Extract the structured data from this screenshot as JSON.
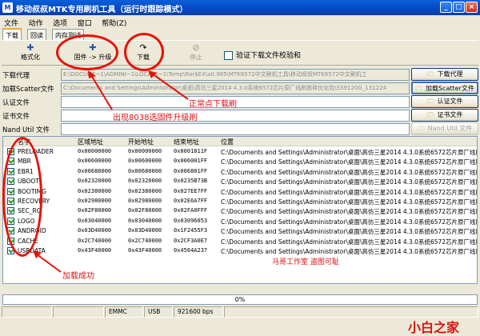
{
  "window": {
    "title": "移动叔叔MTK专用刷机工具（运行时跟踪模式）",
    "icon": "app-icon",
    "min": "_",
    "max": "□",
    "close": "×"
  },
  "menu": [
    "文件",
    "动作",
    "选项",
    "窗口",
    "帮助(Z)"
  ],
  "tabs": [
    "下载",
    "回读",
    "内存测试"
  ],
  "toolbar": {
    "format": "格式化",
    "firmware_upgrade": "固件 -> 升级",
    "download": "下载",
    "stop": "停止",
    "verify_label": "验证下载文件校验和"
  },
  "rows": [
    {
      "label": "下载代理",
      "value": "E:\\DOCUME~1\\ADMINI~1\\LOCALS~1\\Temp\\Rar$EX\\a0.985\\MTK6572中文刷机工具\\移动叔叔MTK6572中文刷机工",
      "button": "下载代理",
      "field_enabled": false,
      "button_enabled": true
    },
    {
      "label": "加载Scatter文件",
      "value": "C:\\Documents and Settings\\Administrator\\桌面\\高仿三星2014 4.3.0系统6572芯片原厂线刷救砖优化包\\SS9120G_131224",
      "button": "加载Scatter文件",
      "field_enabled": false,
      "button_enabled": true
    },
    {
      "label": "认证文件",
      "value": "",
      "button": "认证文件",
      "field_enabled": true,
      "button_enabled": true
    },
    {
      "label": "证书文件",
      "value": "",
      "button": "证书文件",
      "field_enabled": true,
      "button_enabled": true
    },
    {
      "label": "Nand Util 文件",
      "value": "",
      "button": "Nand Util 文件",
      "field_enabled": true,
      "button_enabled": false
    }
  ],
  "list": {
    "columns": [
      "名字",
      "区域地址",
      "开始地址",
      "结束地址",
      "位置"
    ],
    "path_value": "C:\\Documents and Settings\\Administrator\\桌面\\高仿三星2014 4.3.0系统6572芯片原厂线刷",
    "items": [
      {
        "name": "PRELOADER",
        "region": "0x00000000",
        "start": "0x00000000",
        "end": "0x0001811F",
        "checked": true
      },
      {
        "name": "MBR",
        "region": "0x00600000",
        "start": "0x00600000",
        "end": "0x006001FF",
        "checked": true
      },
      {
        "name": "EBR1",
        "region": "0x00680000",
        "start": "0x00680000",
        "end": "0x006801FF",
        "checked": true
      },
      {
        "name": "UBOOT",
        "region": "0x02320000",
        "start": "0x02320000",
        "end": "0x0235B73B",
        "checked": true
      },
      {
        "name": "BOOTIMG",
        "region": "0x02380000",
        "start": "0x02380000",
        "end": "0x027EE7FF",
        "checked": true
      },
      {
        "name": "RECOVERY",
        "region": "0x02980000",
        "start": "0x02980000",
        "end": "0x02E6A7FF",
        "checked": true
      },
      {
        "name": "SEC_RO",
        "region": "0x02F80000",
        "start": "0x02F80000",
        "end": "0x02FA0FFF",
        "checked": true
      },
      {
        "name": "LOGO",
        "region": "0x03040000",
        "start": "0x03040000",
        "end": "0x03096053",
        "checked": true
      },
      {
        "name": "ANDROID",
        "region": "0x03D40000",
        "start": "0x03D40000",
        "end": "0x1F2455F3",
        "checked": true
      },
      {
        "name": "CACHE",
        "region": "0x2C740000",
        "start": "0x2C740000",
        "end": "0x2CF3A0E7",
        "checked": true
      },
      {
        "name": "USRDATA",
        "region": "0x43F40000",
        "start": "0x43F40000",
        "end": "0x4564A237",
        "checked": true
      }
    ]
  },
  "annotations": {
    "normal_download": "正常点下载刷",
    "firmware_upgrade_note": "出现8038选固件升级刷",
    "load_success": "加载成功",
    "watermark": "马哥工作室    盗图可耻",
    "brand": "小白之家"
  },
  "progress": {
    "value": 0,
    "text": "0%"
  },
  "status": [
    "",
    "",
    "EMMC",
    "USB",
    "921600 bps",
    ""
  ],
  "colors": {
    "title_bar": "#0349c4",
    "annotation": "#e8120a",
    "window_bg": "#ece9d8"
  },
  "icons": {
    "format": "format-icon",
    "firmware": "firmware-icon",
    "download": "download-arrow-icon",
    "stop": "stop-icon",
    "folder": "folder-icon"
  }
}
